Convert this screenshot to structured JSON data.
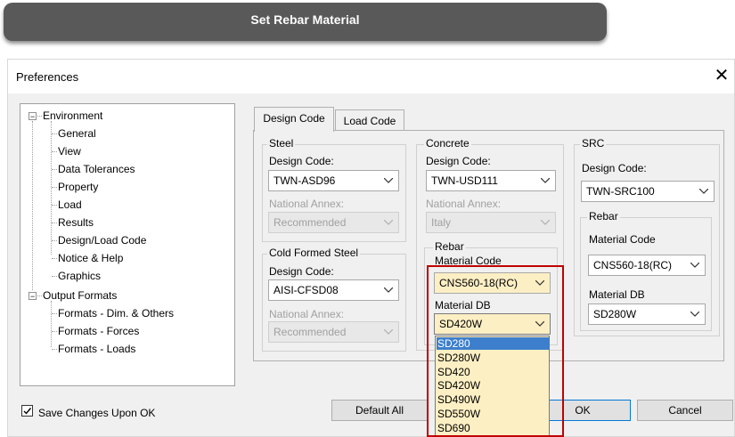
{
  "banner": {
    "title": "Set Rebar Material"
  },
  "window": {
    "title": "Preferences",
    "close_glyph": "✕"
  },
  "tree": {
    "environment": "Environment",
    "env_items": [
      "General",
      "View",
      "Data Tolerances",
      "Property",
      "Load",
      "Results",
      "Design/Load Code",
      "Notice & Help",
      "Graphics"
    ],
    "output": "Output Formats",
    "output_items": [
      "Formats - Dim. & Others",
      "Formats - Forces",
      "Formats - Loads"
    ]
  },
  "tabs": [
    "Design Code",
    "Load Code"
  ],
  "steel": {
    "group": "Steel",
    "code_label": "Design Code:",
    "code_value": "TWN-ASD96",
    "annex_label": "National Annex:",
    "annex_value": "Recommended"
  },
  "cfs": {
    "group": "Cold Formed Steel",
    "code_label": "Design Code:",
    "code_value": "AISI-CFSD08",
    "annex_label": "National Annex:",
    "annex_value": "Recommended"
  },
  "concrete": {
    "group": "Concrete",
    "code_label": "Design Code:",
    "code_value": "TWN-USD111",
    "annex_label": "National Annex:",
    "annex_value": "Italy",
    "rebar": {
      "group": "Rebar",
      "mat_code_label": "Material Code",
      "mat_code_value": "CNS560-18(RC)",
      "mat_db_label": "Material DB",
      "mat_db_value": "SD420W"
    }
  },
  "src": {
    "group": "SRC",
    "code_label": "Design Code:",
    "code_value": "TWN-SRC100",
    "rebar": {
      "group": "Rebar",
      "mat_code_label": "Material Code",
      "mat_code_value": "CNS560-18(RC)",
      "mat_db_label": "Material DB",
      "mat_db_value": "SD280W"
    }
  },
  "dropdown": {
    "options": [
      "SD280",
      "SD280W",
      "SD420",
      "SD420W",
      "SD490W",
      "SD550W",
      "SD690"
    ],
    "selected_index": 0
  },
  "footer": {
    "save_label": "Save Changes Upon OK",
    "save_checked": true,
    "default_all": "Default All",
    "ok": "OK",
    "cancel": "Cancel"
  },
  "colors": {
    "highlight_box": "#c00000",
    "dropdown_bg": "#fdefc4",
    "selected_option": "#3d7fcc",
    "banner_bg": "#595959"
  }
}
